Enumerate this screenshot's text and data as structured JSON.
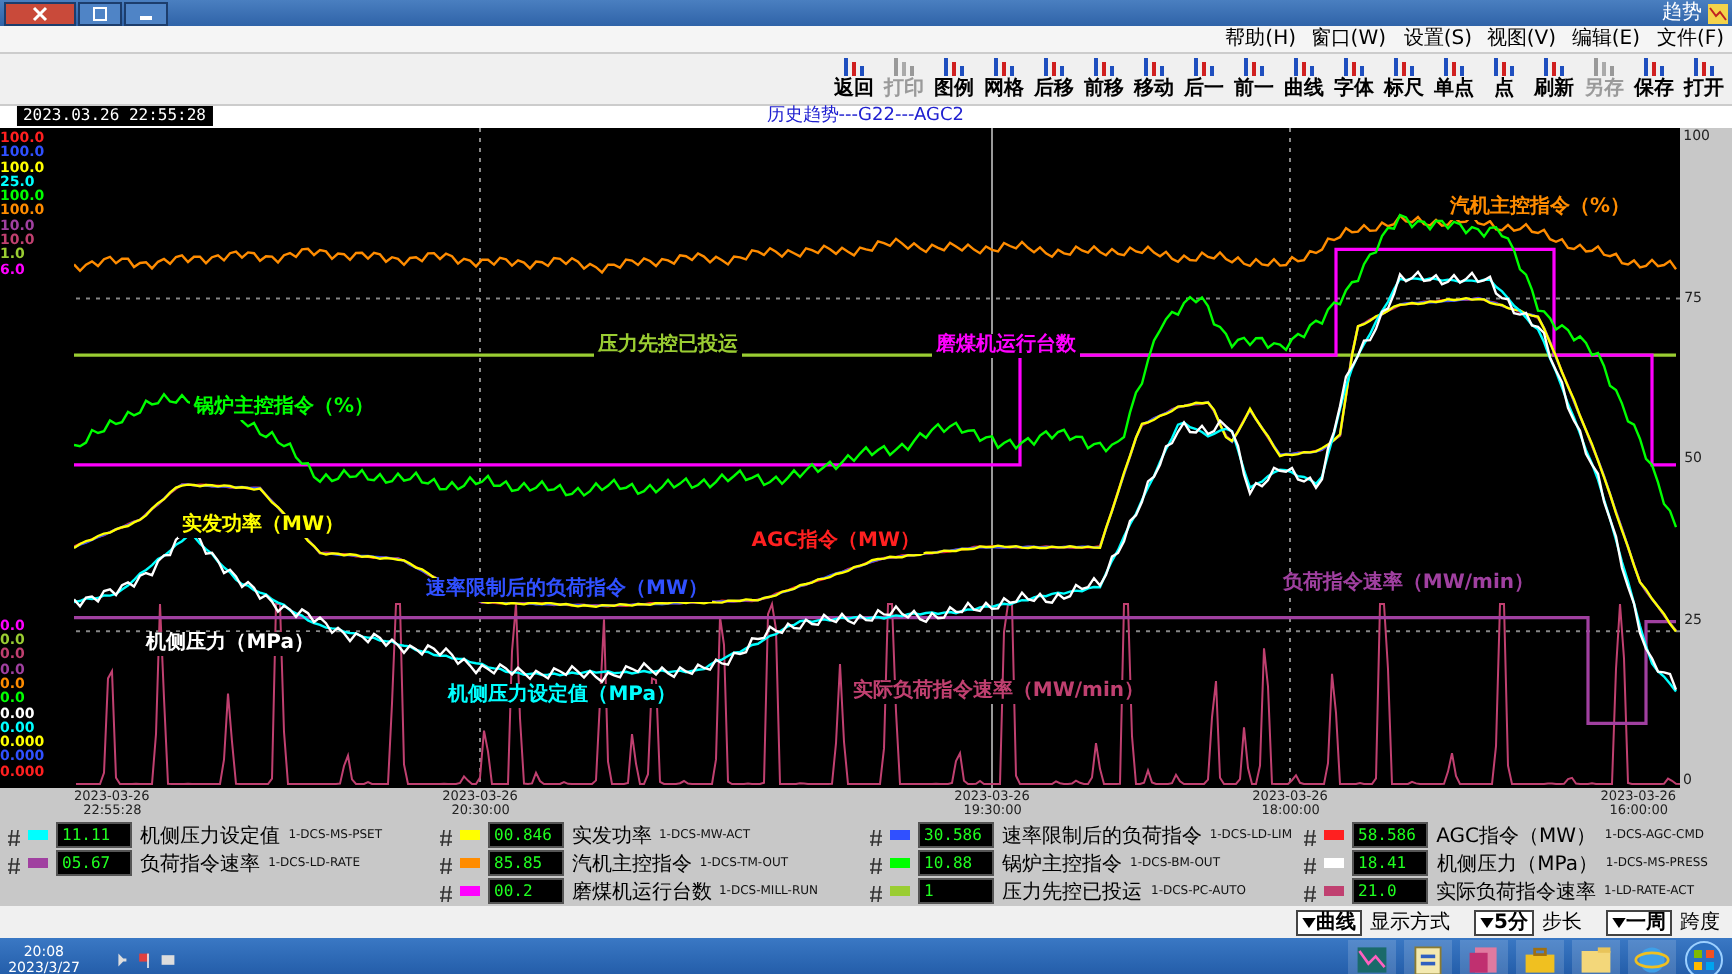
{
  "window": {
    "title": "趋势"
  },
  "menu": [
    "帮助(H)",
    "窗口(W)",
    "设置(S)",
    "视图(V)",
    "编辑(E)",
    "文件(F)"
  ],
  "toolbar": [
    {
      "label": "返回",
      "disabled": false
    },
    {
      "label": "打印",
      "disabled": true
    },
    {
      "label": "图例",
      "disabled": false
    },
    {
      "label": "网格",
      "disabled": false
    },
    {
      "label": "后移",
      "disabled": false
    },
    {
      "label": "前移",
      "disabled": false
    },
    {
      "label": "移动",
      "disabled": false
    },
    {
      "label": "后一",
      "disabled": false
    },
    {
      "label": "前一",
      "disabled": false
    },
    {
      "label": "曲线",
      "disabled": false
    },
    {
      "label": "字体",
      "disabled": false
    },
    {
      "label": "标尺",
      "disabled": false
    },
    {
      "label": "单点",
      "disabled": false
    },
    {
      "label": "点",
      "disabled": false
    },
    {
      "label": "刷新",
      "disabled": false
    },
    {
      "label": "另存",
      "disabled": true
    },
    {
      "label": "保存",
      "disabled": false
    },
    {
      "label": "打开",
      "disabled": false
    }
  ],
  "chart_title": "历史趋势---G22---AGC2",
  "timestamp": "2023.03.26 22:55:28",
  "y_ticks": [
    "100",
    "75",
    "50",
    "25",
    "0"
  ],
  "scale_max": [
    {
      "text": "100.0",
      "color": "#ff2020"
    },
    {
      "text": "100.0",
      "color": "#3050ff"
    },
    {
      "text": "100.0",
      "color": "#ffff00"
    },
    {
      "text": "25.0",
      "color": "#00ffff"
    },
    {
      "text": "100.0",
      "color": "#00ff00"
    },
    {
      "text": "100.0",
      "color": "#ff8c00"
    },
    {
      "text": "10.0",
      "color": "#a040a0"
    },
    {
      "text": "10.0",
      "color": "#c04070"
    },
    {
      "text": "1.0",
      "color": "#9acd32"
    },
    {
      "text": "6.0",
      "color": "#ff00ff"
    }
  ],
  "scale_min": [
    {
      "text": "0.0",
      "color": "#ff00ff"
    },
    {
      "text": "0.0",
      "color": "#9acd32"
    },
    {
      "text": "0.0",
      "color": "#c04070"
    },
    {
      "text": "0.0",
      "color": "#a040a0"
    },
    {
      "text": "0.0",
      "color": "#ff8c00"
    },
    {
      "text": "0.0",
      "color": "#00ff00"
    },
    {
      "text": "0.00",
      "color": "#ffffff"
    },
    {
      "text": "0.00",
      "color": "#00ffff"
    },
    {
      "text": "0.000",
      "color": "#ffff00"
    },
    {
      "text": "0.000",
      "color": "#3050ff"
    },
    {
      "text": "0.000",
      "color": "#ff2020"
    }
  ],
  "series_labels": [
    {
      "text": "汽机主控指令（%）",
      "color": "#ff8c00"
    },
    {
      "text": "压力先控已投运",
      "color": "#9acd32"
    },
    {
      "text": "磨煤机运行台数",
      "color": "#ff00ff"
    },
    {
      "text": "锅炉主控指令（%）",
      "color": "#00ff00"
    },
    {
      "text": "实发功率（MW）",
      "color": "#ffff00"
    },
    {
      "text": "AGC指令（MW）",
      "color": "#ff2020"
    },
    {
      "text": "速率限制后的负荷指令（MW）",
      "color": "#3050ff"
    },
    {
      "text": "机侧压力（MPa）",
      "color": "#ffffff"
    },
    {
      "text": "机侧压力设定值（MPa）",
      "color": "#00ffff"
    },
    {
      "text": "负荷指令速率（MW/min）",
      "color": "#a040a0"
    },
    {
      "text": "实际负荷指令速率（MW/min）",
      "color": "#c04070"
    }
  ],
  "time_labels": [
    {
      "date": "2023-03-26",
      "time": "22:55:28"
    },
    {
      "date": "2023-03-26",
      "time": "20:30:00"
    },
    {
      "date": "2023-03-26",
      "time": "19:30:00"
    },
    {
      "date": "2023-03-26",
      "time": "18:00:00"
    },
    {
      "date": "2023-03-26",
      "time": "16:00:00"
    }
  ],
  "legend_columns": [
    {
      "items": [
        {
          "tag": "1-DCS-MS-PSET",
          "name": "机侧压力设定值",
          "value": "11.11",
          "color": "#00ffff"
        },
        {
          "tag": "1-DCS-LD-RATE",
          "name": "负荷指令速率",
          "value": "05.67",
          "color": "#a040a0"
        }
      ]
    },
    {
      "items": [
        {
          "tag": "1-DCS-MW-ACT",
          "name": "实发功率",
          "value": "00.846",
          "color": "#ffff00"
        },
        {
          "tag": "1-DCS-TM-OUT",
          "name": "汽机主控指令",
          "value": "85.85",
          "color": "#ff8c00"
        },
        {
          "tag": "1-DCS-MILL-RUN",
          "name": "磨煤机运行台数",
          "value": "00.2",
          "color": "#ff00ff"
        }
      ]
    },
    {
      "items": [
        {
          "tag": "1-DCS-LD-LIM",
          "name": "速率限制后的负荷指令",
          "value": "30.586",
          "color": "#3050ff"
        },
        {
          "tag": "1-DCS-BM-OUT",
          "name": "锅炉主控指令",
          "value": "10.88",
          "color": "#00ff00"
        },
        {
          "tag": "1-DCS-PC-AUTO",
          "name": "压力先控已投运",
          "value": "1",
          "color": "#9acd32"
        }
      ]
    },
    {
      "items": [
        {
          "tag": "1-DCS-AGC-CMD",
          "name": "AGC指令（MW）",
          "value": "58.586",
          "color": "#ff2020"
        },
        {
          "tag": "1-DCS-MS-PRESS",
          "name": "机侧压力（MPa）",
          "value": "18.41",
          "color": "#ffffff"
        },
        {
          "tag": "1-LD-RATE-ACT",
          "name": "实际负荷指令速率",
          "value": "21.0",
          "color": "#c04070"
        }
      ]
    }
  ],
  "controls": [
    {
      "label": "显示方式",
      "value": "曲线"
    },
    {
      "label": "步长",
      "value": "5分"
    },
    {
      "label": "跨度",
      "value": "一周"
    }
  ],
  "taskbar": {
    "time": "20:08",
    "date": "2023/3/27"
  }
}
